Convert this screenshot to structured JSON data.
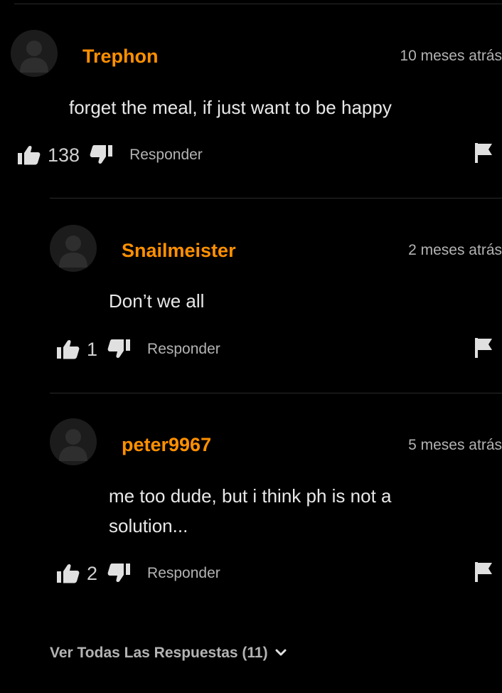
{
  "comments": [
    {
      "username": "Trephon",
      "timestamp": "10 meses atrás",
      "text": "forget the meal, if just want to be happy",
      "likes": "138",
      "reply_label": "Responder"
    },
    {
      "username": "Snailmeister",
      "timestamp": "2 meses atrás",
      "text": "Don’t we all",
      "likes": "1",
      "reply_label": "Responder"
    },
    {
      "username": "peter9967",
      "timestamp": "5 meses atrás",
      "text": "me too dude, but i think ph is not a solution...",
      "likes": "2",
      "reply_label": "Responder"
    }
  ],
  "see_all_replies": "Ver Todas Las Respuestas (11)",
  "icons": {
    "avatar": "user-silhouette-icon",
    "like": "thumbs-up-icon",
    "dislike": "thumbs-down-icon",
    "flag": "flag-icon",
    "expand": "chevron-down-icon"
  },
  "colors": {
    "background": "#000000",
    "username": "#ff9000",
    "muted": "#b3b3b3",
    "text": "#e8e8e8",
    "divider": "#2a2a2a"
  }
}
